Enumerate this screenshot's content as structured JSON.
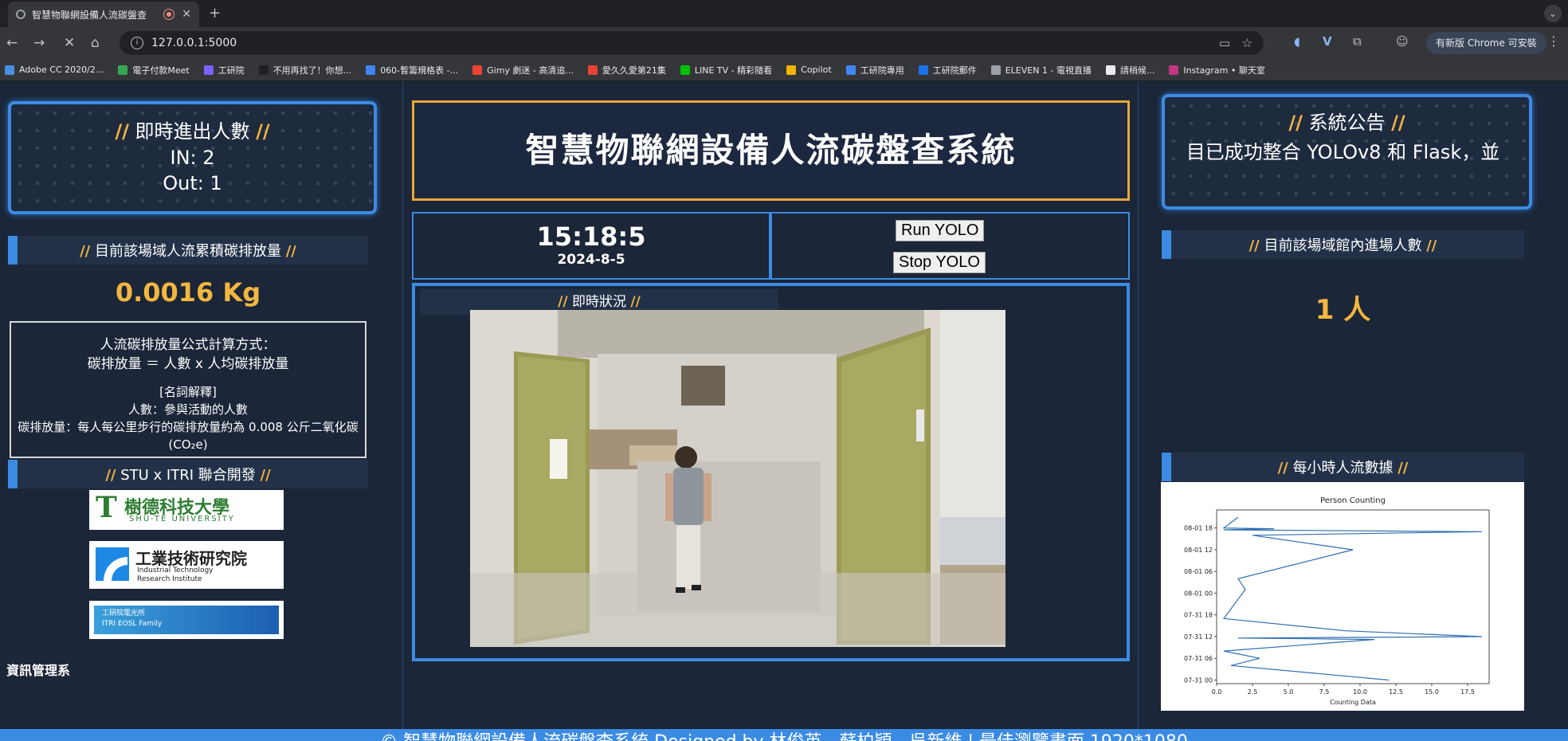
{
  "browser": {
    "tab_title": "智慧物聯網設備人流碳盤查",
    "url": "127.0.0.1:5000",
    "update_label": "有新版 Chrome 可安裝",
    "bookmarks": [
      {
        "label": "Adobe CC 2020/2...",
        "color": "#4a90e2"
      },
      {
        "label": "電子付款Meet",
        "color": "#34a853"
      },
      {
        "label": "工研院",
        "color": "#7b61ff"
      },
      {
        "label": "不用再找了！你想...",
        "color": "#202124"
      },
      {
        "label": "060-暫籌規格表 -...",
        "color": "#4285f4"
      },
      {
        "label": "Gimy 劇迷 - 高清追...",
        "color": "#ea4335"
      },
      {
        "label": "愛久久愛第21集",
        "color": "#ea4335"
      },
      {
        "label": "LINE TV - 精彩隨看",
        "color": "#00c300"
      },
      {
        "label": "Copilot",
        "color": "#f4b400"
      },
      {
        "label": "工研院專用",
        "color": "#4285f4"
      },
      {
        "label": "工研院郵件",
        "color": "#1a73e8"
      },
      {
        "label": "ELEVEN 1 - 電視直播",
        "color": "#9aa0a6"
      },
      {
        "label": "請稍候...",
        "color": "#e8eaed"
      },
      {
        "label": "Instagram • 聊天室",
        "color": "#c13584"
      }
    ]
  },
  "left": {
    "count_title": "即時進出人數",
    "in_label": "IN: 2",
    "out_label": "Out: 1",
    "carbon_header": "目前該場域人流累積碳排放量",
    "carbon_value": "0.0016 Kg",
    "formula_title": "人流碳排放量公式計算方式：",
    "formula": "碳排放量 ＝ 人數 x 人均碳排放量",
    "glossary_title": "[名詞解釋]",
    "glossary_people": "人數：參與活動的人數",
    "glossary_carbon": "碳排放量：每人每公里步行的碳排放量約為 0.008 公斤二氧化碳(CO₂e)",
    "dev_header": "STU x ITRI 聯合開發",
    "logo1_cn": "樹德科技大學",
    "logo1_en": "SHU-TE UNIVERSITY",
    "logo2_cn": "工業技術研究院",
    "logo2_en1": "Industrial Technology",
    "logo2_en2": "Research Institute",
    "logo3_line1": "工研院電光所",
    "logo3_line2": "ITRI EOSL Family",
    "dept": "資訊管理系"
  },
  "center": {
    "title": "智慧物聯網設備人流碳盤查系統",
    "time": "15:18:5",
    "date": "2024-8-5",
    "run_label": "Run YOLO",
    "stop_label": "Stop YOLO",
    "live_title": "即時狀況"
  },
  "right": {
    "notice_title": "系統公告",
    "notice_msg": "目已成功整合 YOLOv8 和 Flask，並",
    "people_header": "目前該場域館內進場人數",
    "people_value": "1 人",
    "chart_header": "每小時人流數據"
  },
  "footer": {
    "text": "© 智慧物聯網設備人流碳盤查系統 Designed by 林俊英、蘇柏穎、吳新維 | 最佳瀏覽畫面 1920*1080"
  },
  "chart_data": {
    "type": "line",
    "title": "Person Counting",
    "xlabel": "Counting Data",
    "ylabel": "",
    "xlim": [
      0,
      19
    ],
    "xticks": [
      "0.0",
      "2.5",
      "5.0",
      "7.5",
      "10.0",
      "12.5",
      "15.0",
      "17.5"
    ],
    "yticks": [
      "07-31 00",
      "07-31 06",
      "07-31 12",
      "07-31 18",
      "08-01 00",
      "08-01 06",
      "08-01 12",
      "08-01 18"
    ],
    "ylim_hours": [
      -1,
      47
    ],
    "series": [
      {
        "points": [
          [
            12.0,
            0
          ],
          [
            1.0,
            4
          ],
          [
            3.0,
            6
          ],
          [
            0.5,
            8
          ],
          [
            11,
            11.2
          ],
          [
            1.5,
            11.6
          ],
          [
            18.5,
            12
          ],
          [
            9,
            13.6
          ],
          [
            0.5,
            17
          ],
          [
            2,
            25
          ],
          [
            1.5,
            28
          ],
          [
            9.5,
            36
          ],
          [
            2.5,
            40
          ],
          [
            18.5,
            41
          ],
          [
            0.5,
            41.5
          ],
          [
            4,
            41.8
          ],
          [
            0.5,
            42
          ],
          [
            1.5,
            45
          ]
        ]
      }
    ]
  },
  "colors": {
    "accent": "#3b8be3",
    "gold": "#f4b63f",
    "background": "#1b2638"
  }
}
